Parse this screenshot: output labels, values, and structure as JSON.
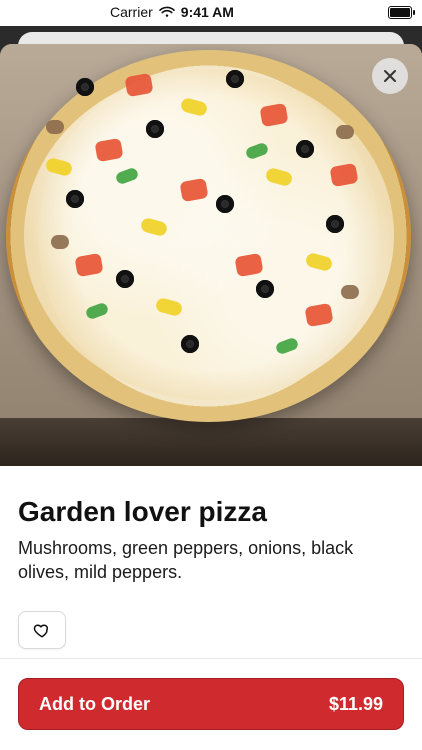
{
  "status_bar": {
    "carrier": "Carrier",
    "time": "9:41 AM",
    "icons": [
      "wifi-icon",
      "battery-icon"
    ]
  },
  "item": {
    "title": "Garden lover pizza",
    "description": "Mushrooms, green peppers, onions, black olives, mild peppers."
  },
  "actions": {
    "close_icon": "close-icon",
    "favorite_icon": "heart-outline-icon",
    "add_to_order_label": "Add to Order",
    "price": "$11.99"
  },
  "colors": {
    "primary": "#cf2b2f",
    "text": "#111111"
  }
}
